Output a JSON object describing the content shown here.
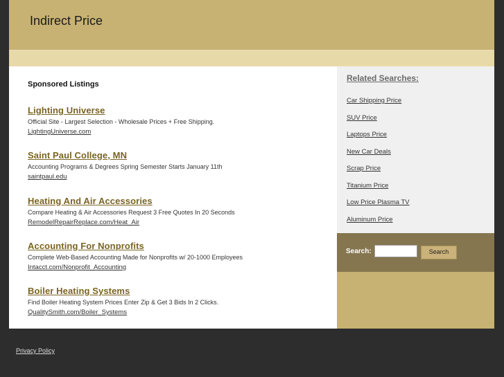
{
  "header": {
    "title": "Indirect Price"
  },
  "main": {
    "sponsored_heading": "Sponsored Listings",
    "listings": [
      {
        "title": "Lighting Universe",
        "description": "Official Site - Largest Selection - Wholesale Prices + Free Shipping.",
        "url": "LightingUniverse.com"
      },
      {
        "title": "Saint Paul College, MN",
        "description": "Accounting Programs & Degrees Spring Semester Starts January 11th",
        "url": "saintpaul.edu"
      },
      {
        "title": "Heating And Air Accessories",
        "description": "Compare Heating & Air Accessories Request 3 Free Quotes In 20 Seconds",
        "url": "RemodelRepairReplace.com/Heat_Air"
      },
      {
        "title": "Accounting For Nonprofits",
        "description": "Complete Web-Based Accounting Made for Nonprofits w/ 20-1000 Employees",
        "url": "Intacct.com/Nonprofit_Accounting"
      },
      {
        "title": "Boiler Heating Systems",
        "description": "Find Boiler Heating System Prices Enter Zip & Get 3 Bids In 2 Clicks.",
        "url": "QualitySmith.com/Boiler_Systems"
      }
    ]
  },
  "sidebar": {
    "related_heading": "Related Searches:",
    "related": [
      "Car Shipping Price",
      "SUV Price",
      "Laptops Price",
      "New Car Deals",
      "Scrap Price",
      "Titanium Price",
      "Low Price Plasma TV",
      "Aluminum Price"
    ],
    "search_label": "Search:",
    "search_value": "",
    "search_button": "Search"
  },
  "footer": {
    "privacy": "Privacy Policy"
  },
  "colors": {
    "header": "#c8b273",
    "subbar": "#e8d9a8",
    "accent_link": "#7a6422",
    "search_panel": "#857650",
    "background": "#2d2d2d"
  }
}
